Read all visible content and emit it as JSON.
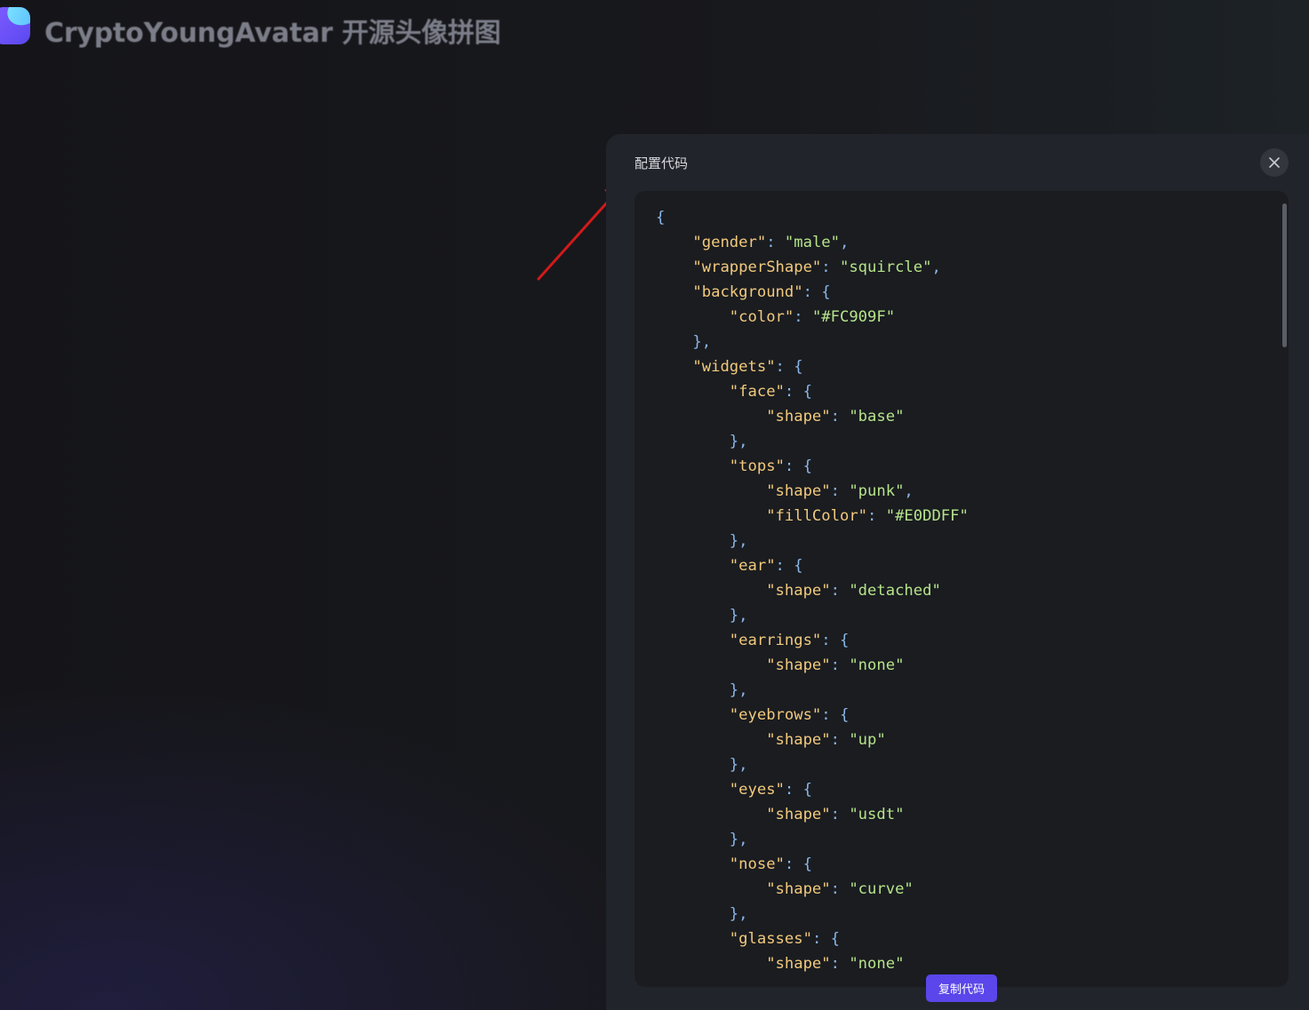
{
  "app": {
    "title": "CryptoYoungAvatar 开源头像拼图"
  },
  "drawer": {
    "title": "配置代码",
    "close_icon": "close-icon",
    "copy_label": "复制代码"
  },
  "code_lines": [
    [
      [
        "p",
        "{"
      ]
    ],
    [
      [
        "p",
        "    "
      ],
      [
        "k",
        "\"gender\""
      ],
      [
        "p",
        ": "
      ],
      [
        "s",
        "\"male\""
      ],
      [
        "p",
        ","
      ]
    ],
    [
      [
        "p",
        "    "
      ],
      [
        "k",
        "\"wrapperShape\""
      ],
      [
        "p",
        ": "
      ],
      [
        "s",
        "\"squircle\""
      ],
      [
        "p",
        ","
      ]
    ],
    [
      [
        "p",
        "    "
      ],
      [
        "k",
        "\"background\""
      ],
      [
        "p",
        ": {"
      ]
    ],
    [
      [
        "p",
        "        "
      ],
      [
        "k",
        "\"color\""
      ],
      [
        "p",
        ": "
      ],
      [
        "s",
        "\"#FC909F\""
      ]
    ],
    [
      [
        "p",
        "    },"
      ]
    ],
    [
      [
        "p",
        "    "
      ],
      [
        "k",
        "\"widgets\""
      ],
      [
        "p",
        ": {"
      ]
    ],
    [
      [
        "p",
        "        "
      ],
      [
        "k",
        "\"face\""
      ],
      [
        "p",
        ": {"
      ]
    ],
    [
      [
        "p",
        "            "
      ],
      [
        "k",
        "\"shape\""
      ],
      [
        "p",
        ": "
      ],
      [
        "s",
        "\"base\""
      ]
    ],
    [
      [
        "p",
        "        },"
      ]
    ],
    [
      [
        "p",
        "        "
      ],
      [
        "k",
        "\"tops\""
      ],
      [
        "p",
        ": {"
      ]
    ],
    [
      [
        "p",
        "            "
      ],
      [
        "k",
        "\"shape\""
      ],
      [
        "p",
        ": "
      ],
      [
        "s",
        "\"punk\""
      ],
      [
        "p",
        ","
      ]
    ],
    [
      [
        "p",
        "            "
      ],
      [
        "k",
        "\"fillColor\""
      ],
      [
        "p",
        ": "
      ],
      [
        "s",
        "\"#E0DDFF\""
      ]
    ],
    [
      [
        "p",
        "        },"
      ]
    ],
    [
      [
        "p",
        "        "
      ],
      [
        "k",
        "\"ear\""
      ],
      [
        "p",
        ": {"
      ]
    ],
    [
      [
        "p",
        "            "
      ],
      [
        "k",
        "\"shape\""
      ],
      [
        "p",
        ": "
      ],
      [
        "s",
        "\"detached\""
      ]
    ],
    [
      [
        "p",
        "        },"
      ]
    ],
    [
      [
        "p",
        "        "
      ],
      [
        "k",
        "\"earrings\""
      ],
      [
        "p",
        ": {"
      ]
    ],
    [
      [
        "p",
        "            "
      ],
      [
        "k",
        "\"shape\""
      ],
      [
        "p",
        ": "
      ],
      [
        "s",
        "\"none\""
      ]
    ],
    [
      [
        "p",
        "        },"
      ]
    ],
    [
      [
        "p",
        "        "
      ],
      [
        "k",
        "\"eyebrows\""
      ],
      [
        "p",
        ": {"
      ]
    ],
    [
      [
        "p",
        "            "
      ],
      [
        "k",
        "\"shape\""
      ],
      [
        "p",
        ": "
      ],
      [
        "s",
        "\"up\""
      ]
    ],
    [
      [
        "p",
        "        },"
      ]
    ],
    [
      [
        "p",
        "        "
      ],
      [
        "k",
        "\"eyes\""
      ],
      [
        "p",
        ": {"
      ]
    ],
    [
      [
        "p",
        "            "
      ],
      [
        "k",
        "\"shape\""
      ],
      [
        "p",
        ": "
      ],
      [
        "s",
        "\"usdt\""
      ]
    ],
    [
      [
        "p",
        "        },"
      ]
    ],
    [
      [
        "p",
        "        "
      ],
      [
        "k",
        "\"nose\""
      ],
      [
        "p",
        ": {"
      ]
    ],
    [
      [
        "p",
        "            "
      ],
      [
        "k",
        "\"shape\""
      ],
      [
        "p",
        ": "
      ],
      [
        "s",
        "\"curve\""
      ]
    ],
    [
      [
        "p",
        "        },"
      ]
    ],
    [
      [
        "p",
        "        "
      ],
      [
        "k",
        "\"glasses\""
      ],
      [
        "p",
        ": {"
      ]
    ],
    [
      [
        "p",
        "            "
      ],
      [
        "k",
        "\"shape\""
      ],
      [
        "p",
        ": "
      ],
      [
        "s",
        "\"none\""
      ]
    ]
  ],
  "colors": {
    "accent": "#5a46ea",
    "annotation_arrow": "#d11a1a",
    "code_key": "#f2c97d",
    "code_string": "#b6e38a",
    "code_punct": "#8bb7e8"
  }
}
